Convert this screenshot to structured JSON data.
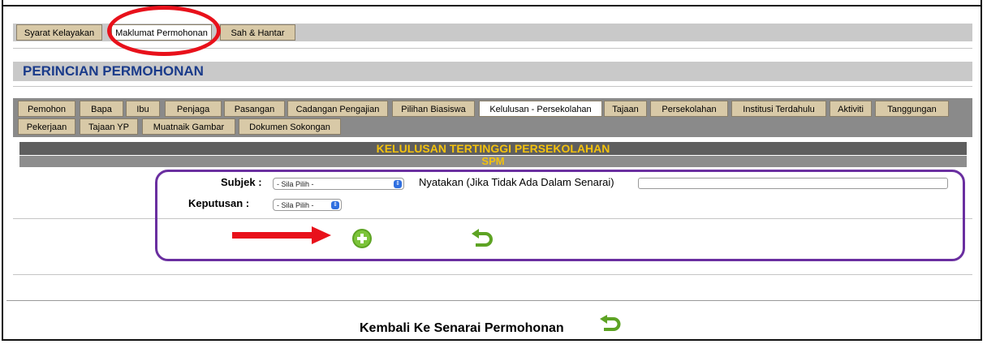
{
  "top_tabs": [
    {
      "label": "Syarat Kelayakan",
      "active": false
    },
    {
      "label": "Maklumat Permohonan",
      "active": true
    },
    {
      "label": "Sah & Hantar",
      "active": false
    }
  ],
  "section_title": "PERINCIAN PERMOHONAN",
  "detail_tabs_row1": [
    {
      "label": "Pemohon",
      "active": false
    },
    {
      "label": "Bapa",
      "active": false
    },
    {
      "label": "Ibu",
      "active": false
    },
    {
      "label": "Penjaga",
      "active": false
    },
    {
      "label": "Pasangan",
      "active": false
    },
    {
      "label": "Cadangan Pengajian",
      "active": false
    },
    {
      "label": "Pilihan Biasiswa",
      "active": false
    },
    {
      "label": "Kelulusan - Persekolahan",
      "active": true
    },
    {
      "label": "Tajaan",
      "active": false
    },
    {
      "label": "Persekolahan",
      "active": false
    },
    {
      "label": "Institusi Terdahulu",
      "active": false
    },
    {
      "label": "Aktiviti",
      "active": false
    },
    {
      "label": "Tanggungan",
      "active": false
    }
  ],
  "detail_tabs_row2": [
    {
      "label": "Pekerjaan",
      "active": false
    },
    {
      "label": "Tajaan YP",
      "active": false
    },
    {
      "label": "Muatnaik Gambar",
      "active": false
    },
    {
      "label": "Dokumen Sokongan",
      "active": false
    }
  ],
  "kelulusan": {
    "heading": "KELULUSAN TERTINGGI PERSEKOLAHAN",
    "subheading": "SPM",
    "subjek_label": "Subjek  :",
    "subjek_value": "- Sila Pilih -",
    "nyatakan_label": "Nyatakan (Jika Tidak Ada Dalam Senarai)",
    "nyatakan_value": "",
    "keputusan_label": "Keputusan  :",
    "keputusan_value": "- Sila Pilih -"
  },
  "footer_link": "Kembali Ke Senarai Permohonan",
  "icons": {
    "add": "add-circle-icon",
    "back": "undo-arrow-icon",
    "select_arrow": "updown-chevron-icon"
  },
  "colors": {
    "title_blue": "#1a3b8a",
    "heading_gold": "#f4c20d",
    "tab_tan": "#d8c9a7",
    "highlight_red": "#e8111b",
    "highlight_purple": "#6a2fa0",
    "icon_green": "#6ab023"
  }
}
